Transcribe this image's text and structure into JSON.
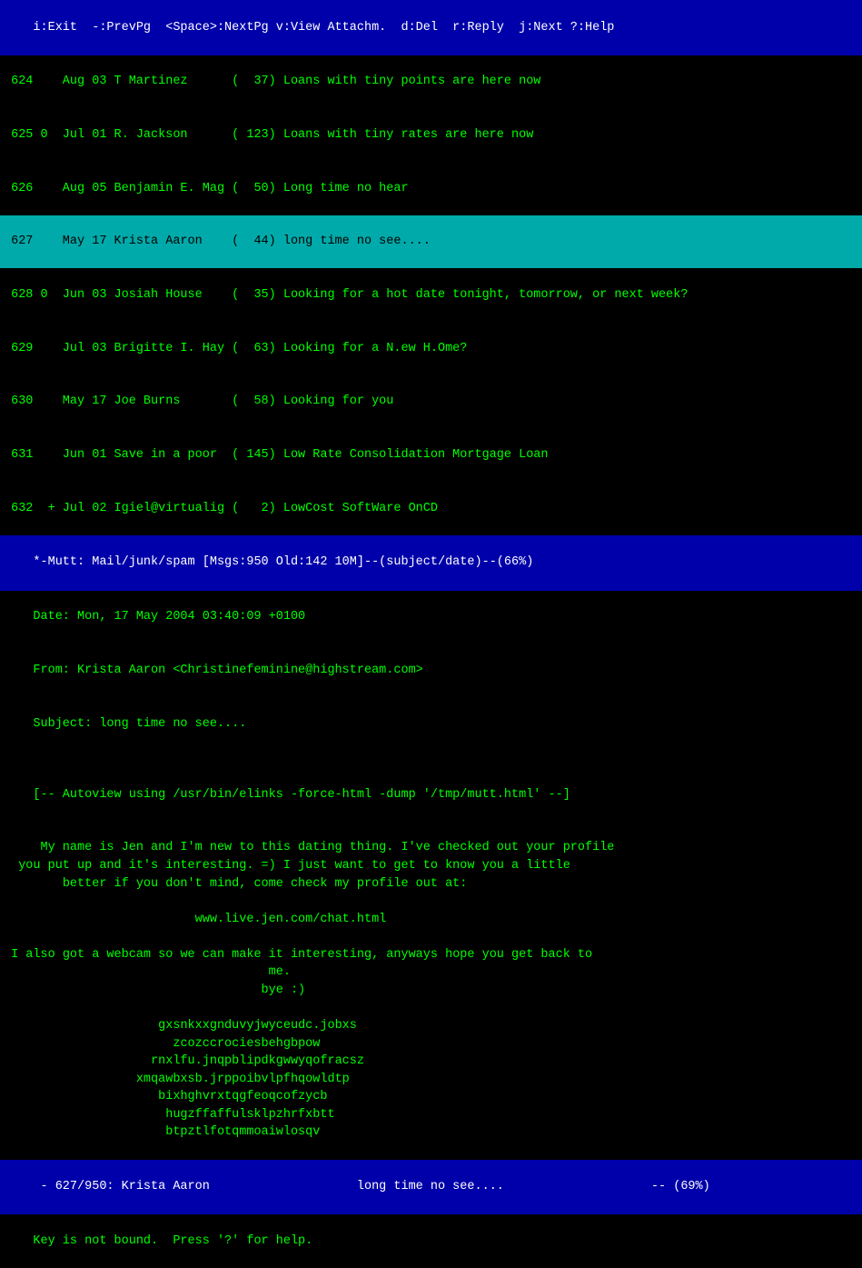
{
  "topbar": {
    "label": "i:Exit  -:PrevPg  <Space>:NextPg v:View Attachm.  d:Del  r:Reply  j:Next ?:Help"
  },
  "emails": [
    {
      "id": "624",
      "flag": " ",
      "date": "Aug 03",
      "sender": "T Martinez",
      "size": "  37",
      "subject": "Loans with tiny points are here now",
      "selected": false
    },
    {
      "id": "625",
      "flag": "0",
      "date": "Jul 01",
      "sender": "R. Jackson",
      "size": " 123",
      "subject": "Loans with tiny rates are here now",
      "selected": false
    },
    {
      "id": "626",
      "flag": " ",
      "date": "Aug 05",
      "sender": "Benjamin E. Mag",
      "size": "  50",
      "subject": "Long time no hear",
      "selected": false
    },
    {
      "id": "627",
      "flag": " ",
      "date": "May 17",
      "sender": "Krista Aaron",
      "size": "  44",
      "subject": "long time no see....",
      "selected": true
    },
    {
      "id": "628",
      "flag": "0",
      "date": "Jun 03",
      "sender": "Josiah House",
      "size": "  35",
      "subject": "Looking for a hot date tonight, tomorrow, or next week?",
      "selected": false
    },
    {
      "id": "629",
      "flag": " ",
      "date": "Jul 03",
      "sender": "Brigitte I. Hay",
      "size": "  63",
      "subject": "Looking for a N.ew H.Ome?",
      "selected": false
    },
    {
      "id": "630",
      "flag": " ",
      "date": "May 17",
      "sender": "Joe Burns",
      "size": "  58",
      "subject": "Looking for you",
      "selected": false
    },
    {
      "id": "631",
      "flag": " ",
      "date": "Jun 01",
      "sender": "Save in a poor",
      "size": " 145",
      "subject": "Low Rate Consolidation Mortgage Loan",
      "selected": false
    },
    {
      "id": "632",
      "flag": "+",
      "date": "Jul 02",
      "sender": "Igiel@virtualig",
      "size": "   2",
      "subject": "LowCost SoftWare OnCD",
      "selected": false
    }
  ],
  "statusbar": {
    "label": "*-Mutt: Mail/junk/spam [Msgs:950 Old:142 10M]--(subject/date)--(66%)"
  },
  "emailheader": {
    "date": "Date: Mon, 17 May 2004 03:40:09 +0100",
    "from": "From: Krista Aaron <Christinefeminine@highstream.com>",
    "subject": "Subject: long time no see...."
  },
  "autoview": {
    "line": "[-- Autoview using /usr/bin/elinks -force-html -dump '/tmp/mutt.html' --]"
  },
  "body": {
    "text": " My name is Jen and I'm new to this dating thing. I've checked out your profile\n  you put up and it's interesting. =) I just want to get to know you a little\n        better if you don't mind, come check my profile out at:\n\n                          www.live.jen.com/chat.html\n\n I also got a webcam so we can make it interesting, anyways hope you get back to\n                                    me.\n                                   bye :)\n\n                     gxsnkxxgnduvyjwyceudc.jobxs\n                       zcozccrociesbehgbpow\n                    rnxlfu.jnqpblipdkgwwyqofracsz\n                  xmqawbxsb.jrppoibvlpfhqowldtp\n                     bixhghvrxtqgfeoqcofzycb\n                      hugzffaffulsklpzhrfxbtt\n                      btpztlfotqmmoaiwlosqv"
  },
  "bottombar": {
    "label": " - 627/950: Krista Aaron                    long time no see....                    -- (69%)"
  },
  "keyhelp": {
    "text": "Key is not bound.  Press '?' for help."
  }
}
